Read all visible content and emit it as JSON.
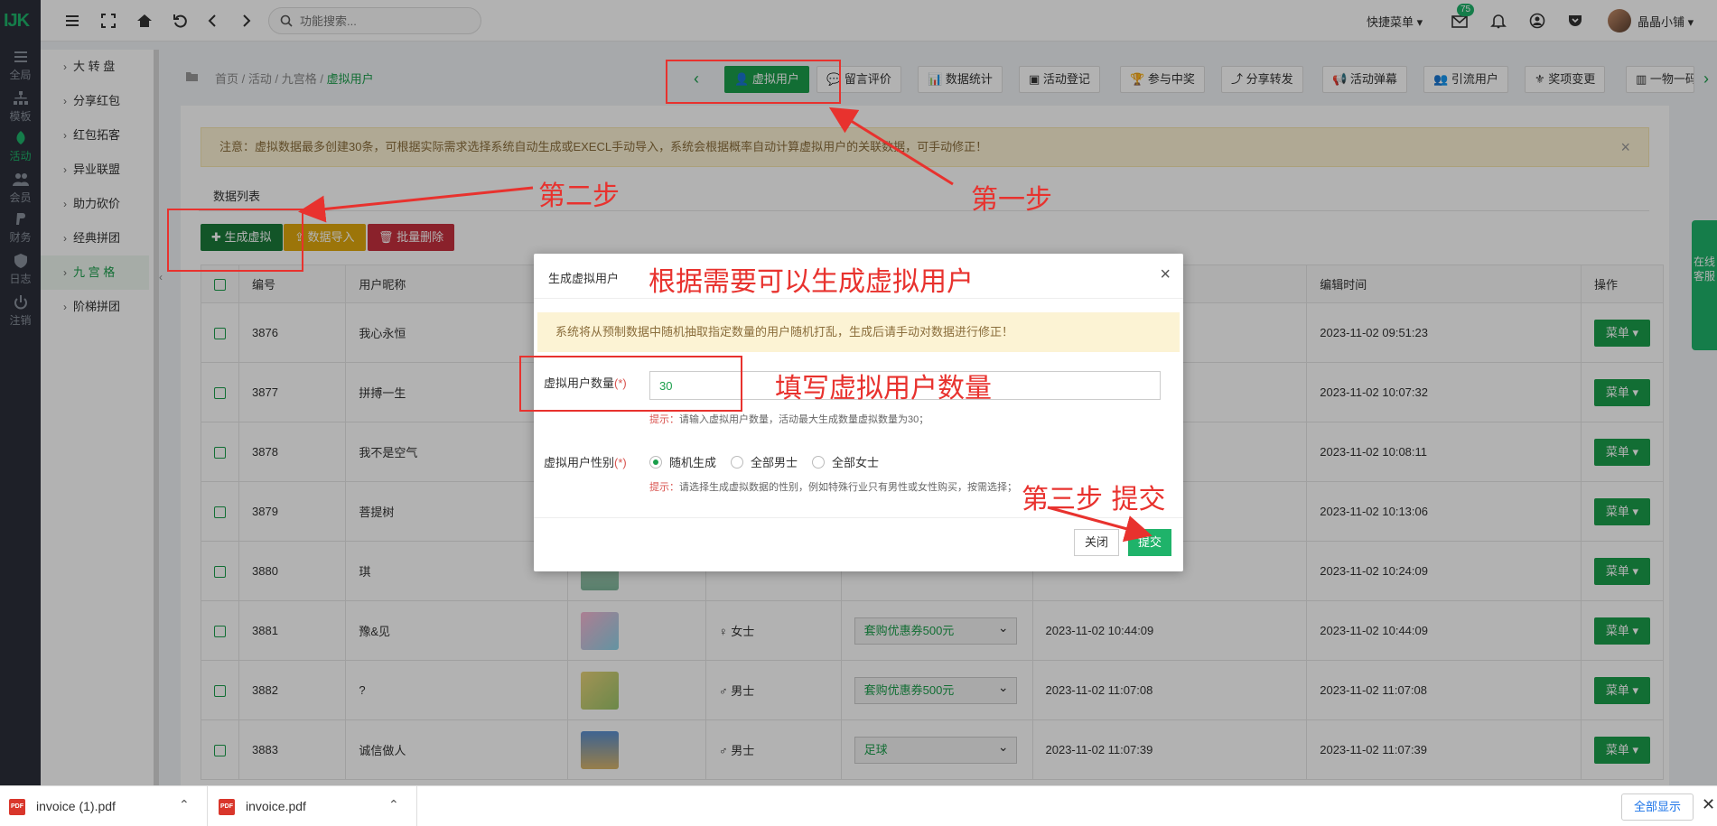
{
  "rail": {
    "logo": "IJK",
    "items": [
      {
        "label": "全局",
        "icon": "sliders-icon"
      },
      {
        "label": "模板",
        "icon": "sitemap-icon"
      },
      {
        "label": "活动",
        "icon": "leaf-icon"
      },
      {
        "label": "会员",
        "icon": "users-icon"
      },
      {
        "label": "财务",
        "icon": "paypal-icon"
      },
      {
        "label": "日志",
        "icon": "shield-icon"
      },
      {
        "label": "注销",
        "icon": "power-icon"
      }
    ],
    "active_color": "#1fb36a"
  },
  "submenu": {
    "items": [
      "大 转 盘",
      "分享红包",
      "红包拓客",
      "异业联盟",
      "助力砍价",
      "经典拼团",
      "九 宫 格",
      "阶梯拼团"
    ],
    "active_index": 6
  },
  "topbar": {
    "search_placeholder": "功能搜索...",
    "quick_menu": "快捷菜单",
    "mail_badge": "75",
    "username": "晶晶小铺"
  },
  "breadcrumb": {
    "items": [
      "首页",
      "活动",
      "九宫格"
    ],
    "current": "虚拟用户"
  },
  "tabs": [
    "虚拟用户",
    "留言评价",
    "数据统计",
    "活动登记",
    "参与中奖",
    "分享转发",
    "活动弹幕",
    "引流用户",
    "奖项变更",
    "一物一码"
  ],
  "notice": "注意：虚拟数据最多创建30条，可根据实际需求选择系统自动生成或EXECL手动导入，系统会根据概率自动计算虚拟用户的关联数据，可手动修正！",
  "list_tab": "数据列表",
  "actions": {
    "generate": "生成虚拟",
    "import": "数据导入",
    "batch_delete": "批量删除"
  },
  "table": {
    "headers": [
      "编号",
      "用户昵称",
      "",
      "",
      "",
      "",
      "编辑时间",
      "操作"
    ],
    "menu_label": "菜单",
    "rows": [
      {
        "id": "3876",
        "name": "我心永恒",
        "gender": "",
        "prize": "",
        "time1": "",
        "time2": "2023-11-02 09:51:23"
      },
      {
        "id": "3877",
        "name": "拼搏一生",
        "gender": "",
        "prize": "",
        "time1": "",
        "time2": "2023-11-02 10:07:32"
      },
      {
        "id": "3878",
        "name": "我不是空气",
        "gender": "",
        "prize": "",
        "time1": "",
        "time2": "2023-11-02 10:08:11"
      },
      {
        "id": "3879",
        "name": "菩提树",
        "gender": "",
        "prize": "",
        "time1": "",
        "time2": "2023-11-02 10:13:06"
      },
      {
        "id": "3880",
        "name": "琪",
        "gender": "",
        "prize": "",
        "time1": "",
        "time2": "2023-11-02 10:24:09"
      },
      {
        "id": "3881",
        "name": "豫&见",
        "gender": "♀ 女士",
        "prize": "套购优惠券500元",
        "time1": "2023-11-02 10:44:09",
        "time2": "2023-11-02 10:44:09"
      },
      {
        "id": "3882",
        "name": "?",
        "gender": "♂ 男士",
        "prize": "套购优惠券500元",
        "time1": "2023-11-02 11:07:08",
        "time2": "2023-11-02 11:07:08"
      },
      {
        "id": "3883",
        "name": "诚信做人",
        "gender": "♂ 男士",
        "prize": "足球",
        "time1": "2023-11-02 11:07:39",
        "time2": "2023-11-02 11:07:39"
      }
    ]
  },
  "modal": {
    "title": "生成虚拟用户",
    "notice": "系统将从预制数据中随机抽取指定数量的用户随机打乱，生成后请手动对数据进行修正！",
    "qty_label": "虚拟用户数量",
    "required_mark": "(*)",
    "qty_value": "30",
    "qty_hint_key": "提示：",
    "qty_hint": "请输入虚拟用户数量，活动最大生成数量虚拟数量为30；",
    "gender_label": "虚拟用户性别",
    "gender_options": [
      "随机生成",
      "全部男士",
      "全部女士"
    ],
    "gender_selected": 0,
    "gender_hint_key": "提示：",
    "gender_hint": "请选择生成虚拟数据的性别，例如特殊行业只有男性或女性购买，按需选择；",
    "close_label": "关闭",
    "submit_label": "提交"
  },
  "annotations": {
    "step1": "第一步",
    "step2": "第二步",
    "step3": "第三步 提交",
    "modal_caption": "根据需要可以生成虚拟用户",
    "qty_caption": "填写虚拟用户数量",
    "color": "#e8322e"
  },
  "side_float": "在线客服",
  "downloads": {
    "files": [
      "invoice (1).pdf",
      "invoice.pdf"
    ],
    "show_all": "全部显示"
  }
}
